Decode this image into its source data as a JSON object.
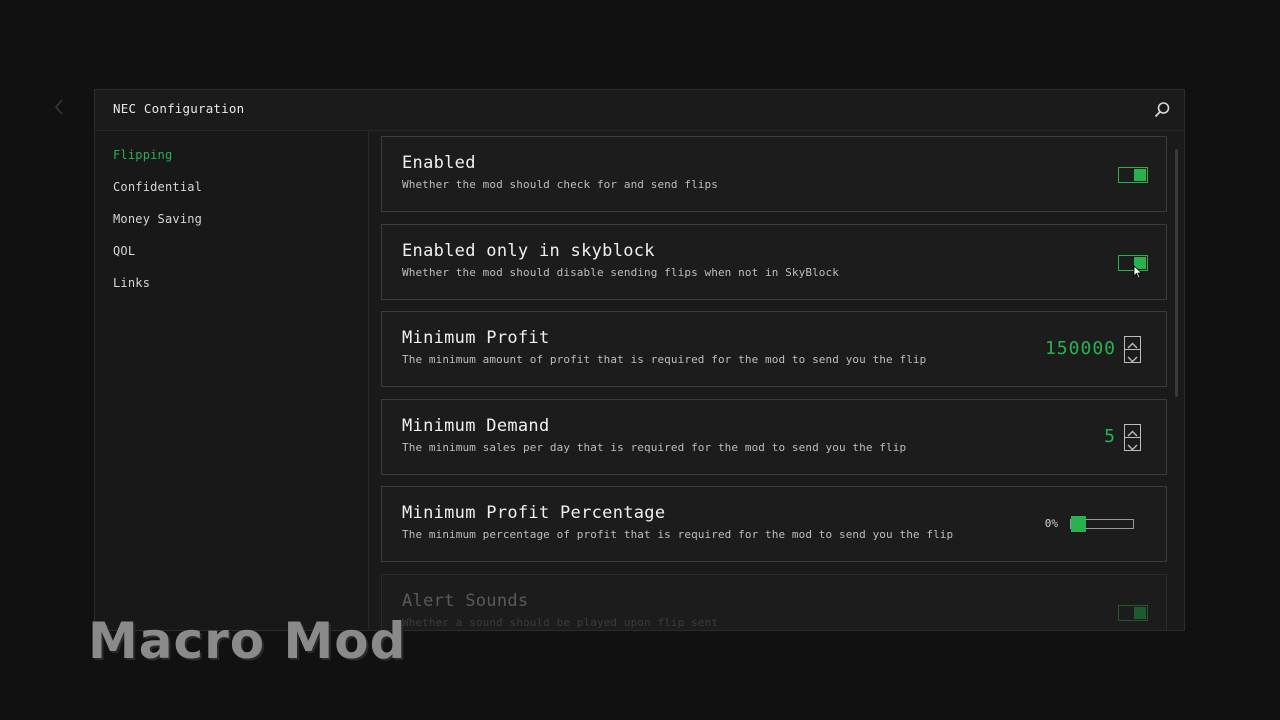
{
  "window": {
    "title": "NEC Configuration"
  },
  "sidebar": {
    "items": [
      {
        "label": "Flipping",
        "active": true
      },
      {
        "label": "Confidential",
        "active": false
      },
      {
        "label": "Money Saving",
        "active": false
      },
      {
        "label": "QOL",
        "active": false
      },
      {
        "label": "Links",
        "active": false
      }
    ]
  },
  "settings": [
    {
      "title": "Enabled",
      "description": "Whether the mod should check for and send flips",
      "control": "toggle",
      "state": "on"
    },
    {
      "title": "Enabled only in skyblock",
      "description": "Whether the mod should disable sending flips when not in SkyBlock",
      "control": "toggle",
      "state": "on"
    },
    {
      "title": "Minimum Profit",
      "description": "The minimum amount of profit that is required for the mod to send you the flip",
      "control": "number",
      "value": "150000"
    },
    {
      "title": "Minimum Demand",
      "description": "The minimum sales per day that is required for the mod to send you the flip",
      "control": "number",
      "value": "5"
    },
    {
      "title": "Minimum Profit Percentage",
      "description": "The minimum percentage of profit that is required for the mod to send you the flip",
      "control": "slider",
      "value_label": "0%",
      "level": 0
    },
    {
      "title": "Alert Sounds",
      "description": "Whether a sound should be played upon flip sent",
      "control": "toggle",
      "state": "on"
    }
  ],
  "watermark": "Macro Mod",
  "colors": {
    "accent": "#27b24f",
    "background": "#111111",
    "panel": "#181818",
    "card_border": "#3c3c3c"
  },
  "icons": {
    "search": "search-icon",
    "back": "chevron-left-icon",
    "step_up": "chevron-up-icon",
    "step_down": "chevron-down-icon"
  }
}
